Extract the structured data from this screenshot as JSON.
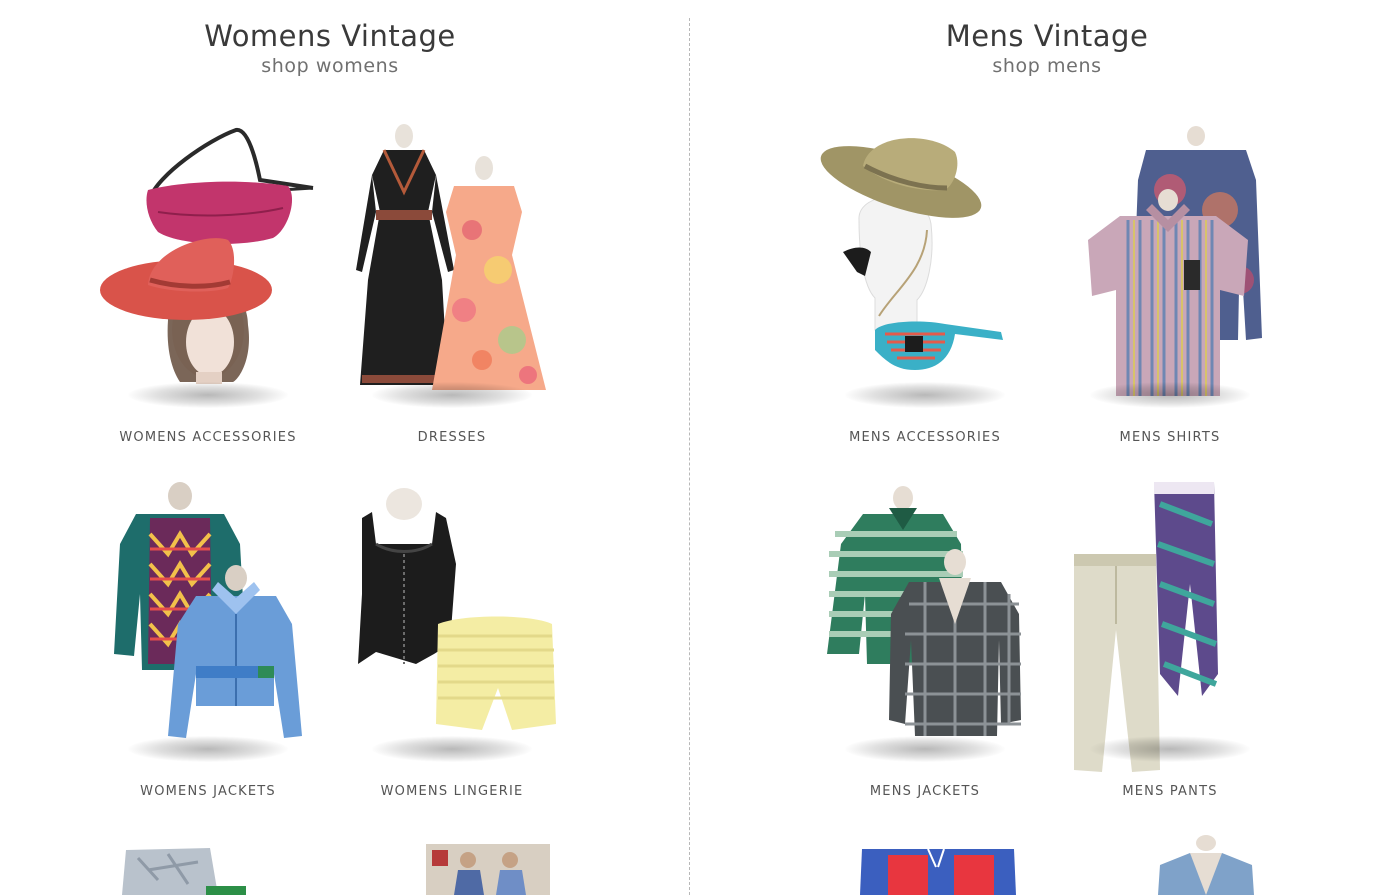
{
  "womens": {
    "title": "Womens Vintage",
    "shop_link": "shop womens",
    "categories": [
      {
        "label": "WOMENS ACCESSORIES"
      },
      {
        "label": "DRESSES"
      },
      {
        "label": "WOMENS JACKETS"
      },
      {
        "label": "WOMENS LINGERIE"
      }
    ]
  },
  "mens": {
    "title": "Mens Vintage",
    "shop_link": "shop mens",
    "categories": [
      {
        "label": "MENS ACCESSORIES"
      },
      {
        "label": "MENS SHIRTS"
      },
      {
        "label": "MENS JACKETS"
      },
      {
        "label": "MENS PANTS"
      }
    ]
  }
}
